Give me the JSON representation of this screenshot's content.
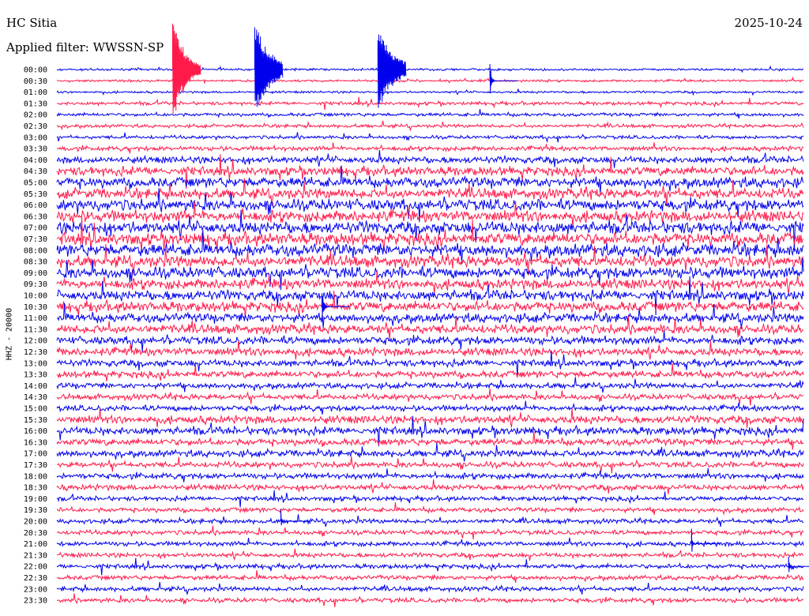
{
  "header": {
    "station": "HC Sitia",
    "date": "2025-10-24",
    "filter_label": "Applied filter: WWSSN-SP",
    "channel_label": "HHZ - 20000"
  },
  "chart_data": {
    "type": "line",
    "title": "HC Sitia",
    "subtitle": "Applied filter: WWSSN-SP",
    "ylabel": "HHZ - 20000",
    "rows": [
      "00:00",
      "00:30",
      "01:00",
      "01:30",
      "02:00",
      "02:30",
      "03:00",
      "03:30",
      "04:00",
      "04:30",
      "05:00",
      "05:30",
      "06:00",
      "06:30",
      "07:00",
      "07:30",
      "08:00",
      "08:30",
      "09:00",
      "09:30",
      "10:00",
      "10:30",
      "11:00",
      "11:30",
      "12:00",
      "12:30",
      "13:00",
      "13:30",
      "14:00",
      "14:30",
      "15:00",
      "15:30",
      "16:00",
      "16:30",
      "17:00",
      "17:30",
      "18:00",
      "18:30",
      "19:00",
      "19:30",
      "20:00",
      "20:30",
      "21:00",
      "21:30",
      "22:00",
      "22:30",
      "23:00",
      "23:30"
    ],
    "row_colors": [
      "#0000ee",
      "#ff1a4a"
    ],
    "noise_amplitude": [
      2,
      2,
      2,
      3,
      3,
      3,
      3,
      4,
      6,
      8,
      9,
      9,
      10,
      10,
      11,
      11,
      11,
      10,
      10,
      9,
      9,
      9,
      8,
      8,
      7,
      7,
      6,
      6,
      5,
      5,
      5,
      7,
      7,
      6,
      6,
      5,
      5,
      5,
      4,
      4,
      4,
      4,
      4,
      4,
      4,
      4,
      4,
      4
    ],
    "events": [
      {
        "row": 0,
        "time_fraction": 0.155,
        "amplitude": 70,
        "decay": 0.002,
        "color": "#ff1a4a"
      },
      {
        "row": 0,
        "time_fraction": 0.265,
        "amplitude": 60,
        "decay": 0.0015,
        "color": "#0000ee"
      },
      {
        "row": 0,
        "time_fraction": 0.43,
        "amplitude": 55,
        "decay": 0.0015,
        "color": "#0000ee"
      },
      {
        "row": 1,
        "time_fraction": 0.58,
        "amplitude": 30,
        "decay": 0.02,
        "color": "#0000ee"
      },
      {
        "row": 21,
        "time_fraction": 0.355,
        "amplitude": 25,
        "decay": 0.015,
        "color": "#0000ee"
      },
      {
        "row": 40,
        "time_fraction": 0.3,
        "amplitude": 22,
        "decay": 0.05,
        "color": "#0000ee"
      },
      {
        "row": 42,
        "time_fraction": 0.85,
        "amplitude": 24,
        "decay": 0.04,
        "color": "#0000ee"
      },
      {
        "row": 44,
        "time_fraction": 0.98,
        "amplitude": 18,
        "decay": 0.03,
        "color": "#0000ee"
      }
    ]
  }
}
